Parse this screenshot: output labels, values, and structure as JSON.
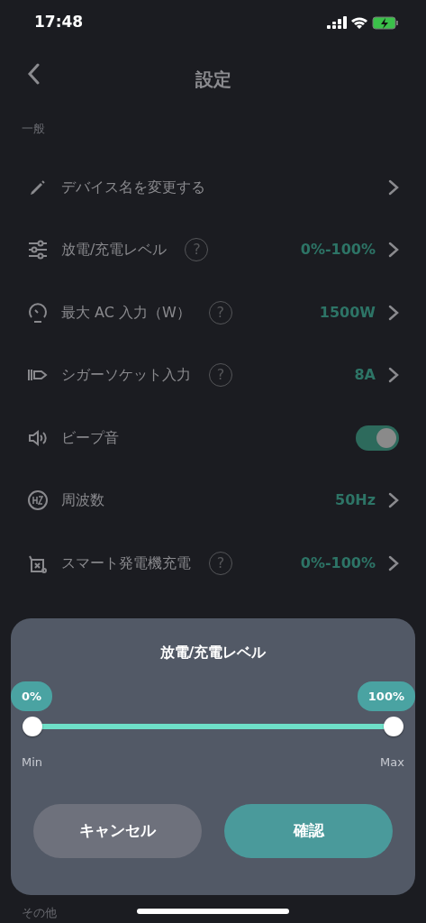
{
  "status_bar": {
    "time": "17:48"
  },
  "header": {
    "title": "設定"
  },
  "sections": [
    {
      "title": "一般",
      "rows": [
        {
          "kind": "link",
          "label": "デバイス名を変更する"
        },
        {
          "kind": "link",
          "label": "放電/充電レベル",
          "help": "?",
          "value": "0%-100%"
        },
        {
          "kind": "link",
          "label": "最大 AC 入力（W）",
          "help": "?",
          "value": "1500W"
        },
        {
          "kind": "link",
          "label": "シガーソケット入力",
          "help": "?",
          "value": "8A"
        },
        {
          "kind": "toggle",
          "label": "ビープ音",
          "on": true
        },
        {
          "kind": "link",
          "label": "周波数",
          "value": "50Hz"
        },
        {
          "kind": "link",
          "label": "スマート発電機充電",
          "help": "?",
          "value": "0%-100%"
        }
      ]
    },
    {
      "title": "その他"
    }
  ],
  "sheet": {
    "title": "放電/充電レベル",
    "low_badge": "0%",
    "high_badge": "100%",
    "thumbs": [
      {
        "level": 0
      },
      {
        "level": 1
      }
    ],
    "min_label": "Min",
    "max_label": "Max",
    "buttons": [
      {
        "kind": "secondary",
        "label": "キャンセル"
      },
      {
        "kind": "primary",
        "label": "確認"
      }
    ]
  }
}
